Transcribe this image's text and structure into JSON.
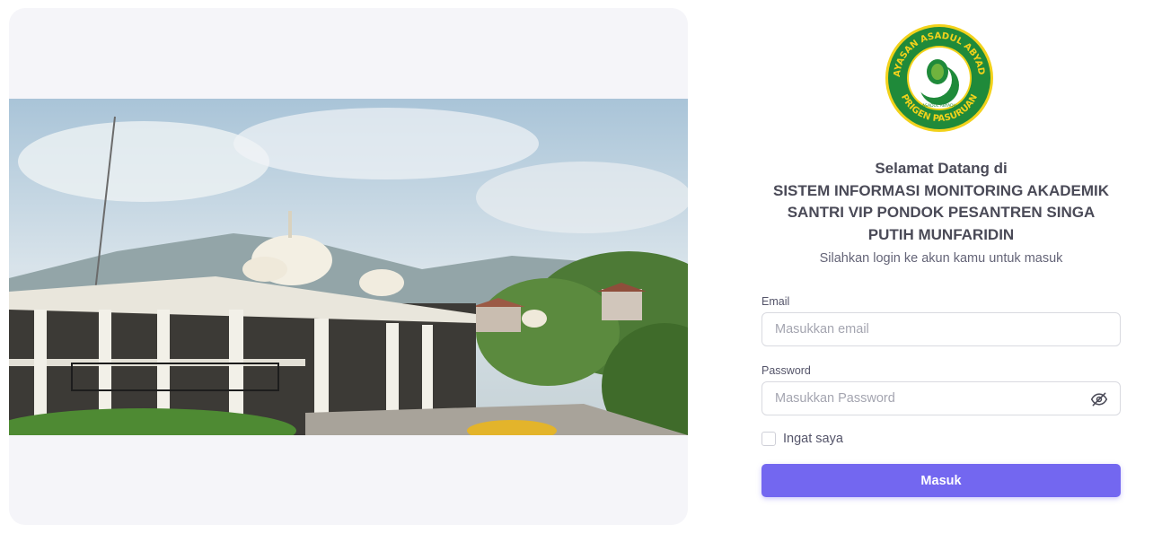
{
  "brand": {
    "logo_ring_text_top": "YAYASAN ASADUL ABYADH",
    "logo_ring_text_bottom": "PRIGEN PASURUAN",
    "logo_inner_text": "ASADUL ABYADH",
    "colors": {
      "logo_ring": "#1f8a3a",
      "logo_border": "#f2d21b",
      "logo_text": "#f2d21b"
    }
  },
  "welcome": {
    "line1": "Selamat Datang di",
    "line2": "SISTEM INFORMASI MONITORING AKADEMIK",
    "line3": "SANTRI VIP PONDOK PESANTREN SINGA",
    "line4": "PUTIH MUNFARIDIN",
    "subtitle": "Silahkan login ke akun kamu untuk masuk"
  },
  "form": {
    "email_label": "Email",
    "email_placeholder": "Masukkan email",
    "email_value": "",
    "password_label": "Password",
    "password_placeholder": "Masukkan Password",
    "password_value": "",
    "password_toggle_icon": "eye-off-icon",
    "remember_label": "Ingat saya",
    "remember_checked": false,
    "submit_label": "Masuk"
  },
  "theme": {
    "primary": "#7367f0",
    "text": "#4a4a57",
    "panel_bg": "#f5f5f9"
  }
}
